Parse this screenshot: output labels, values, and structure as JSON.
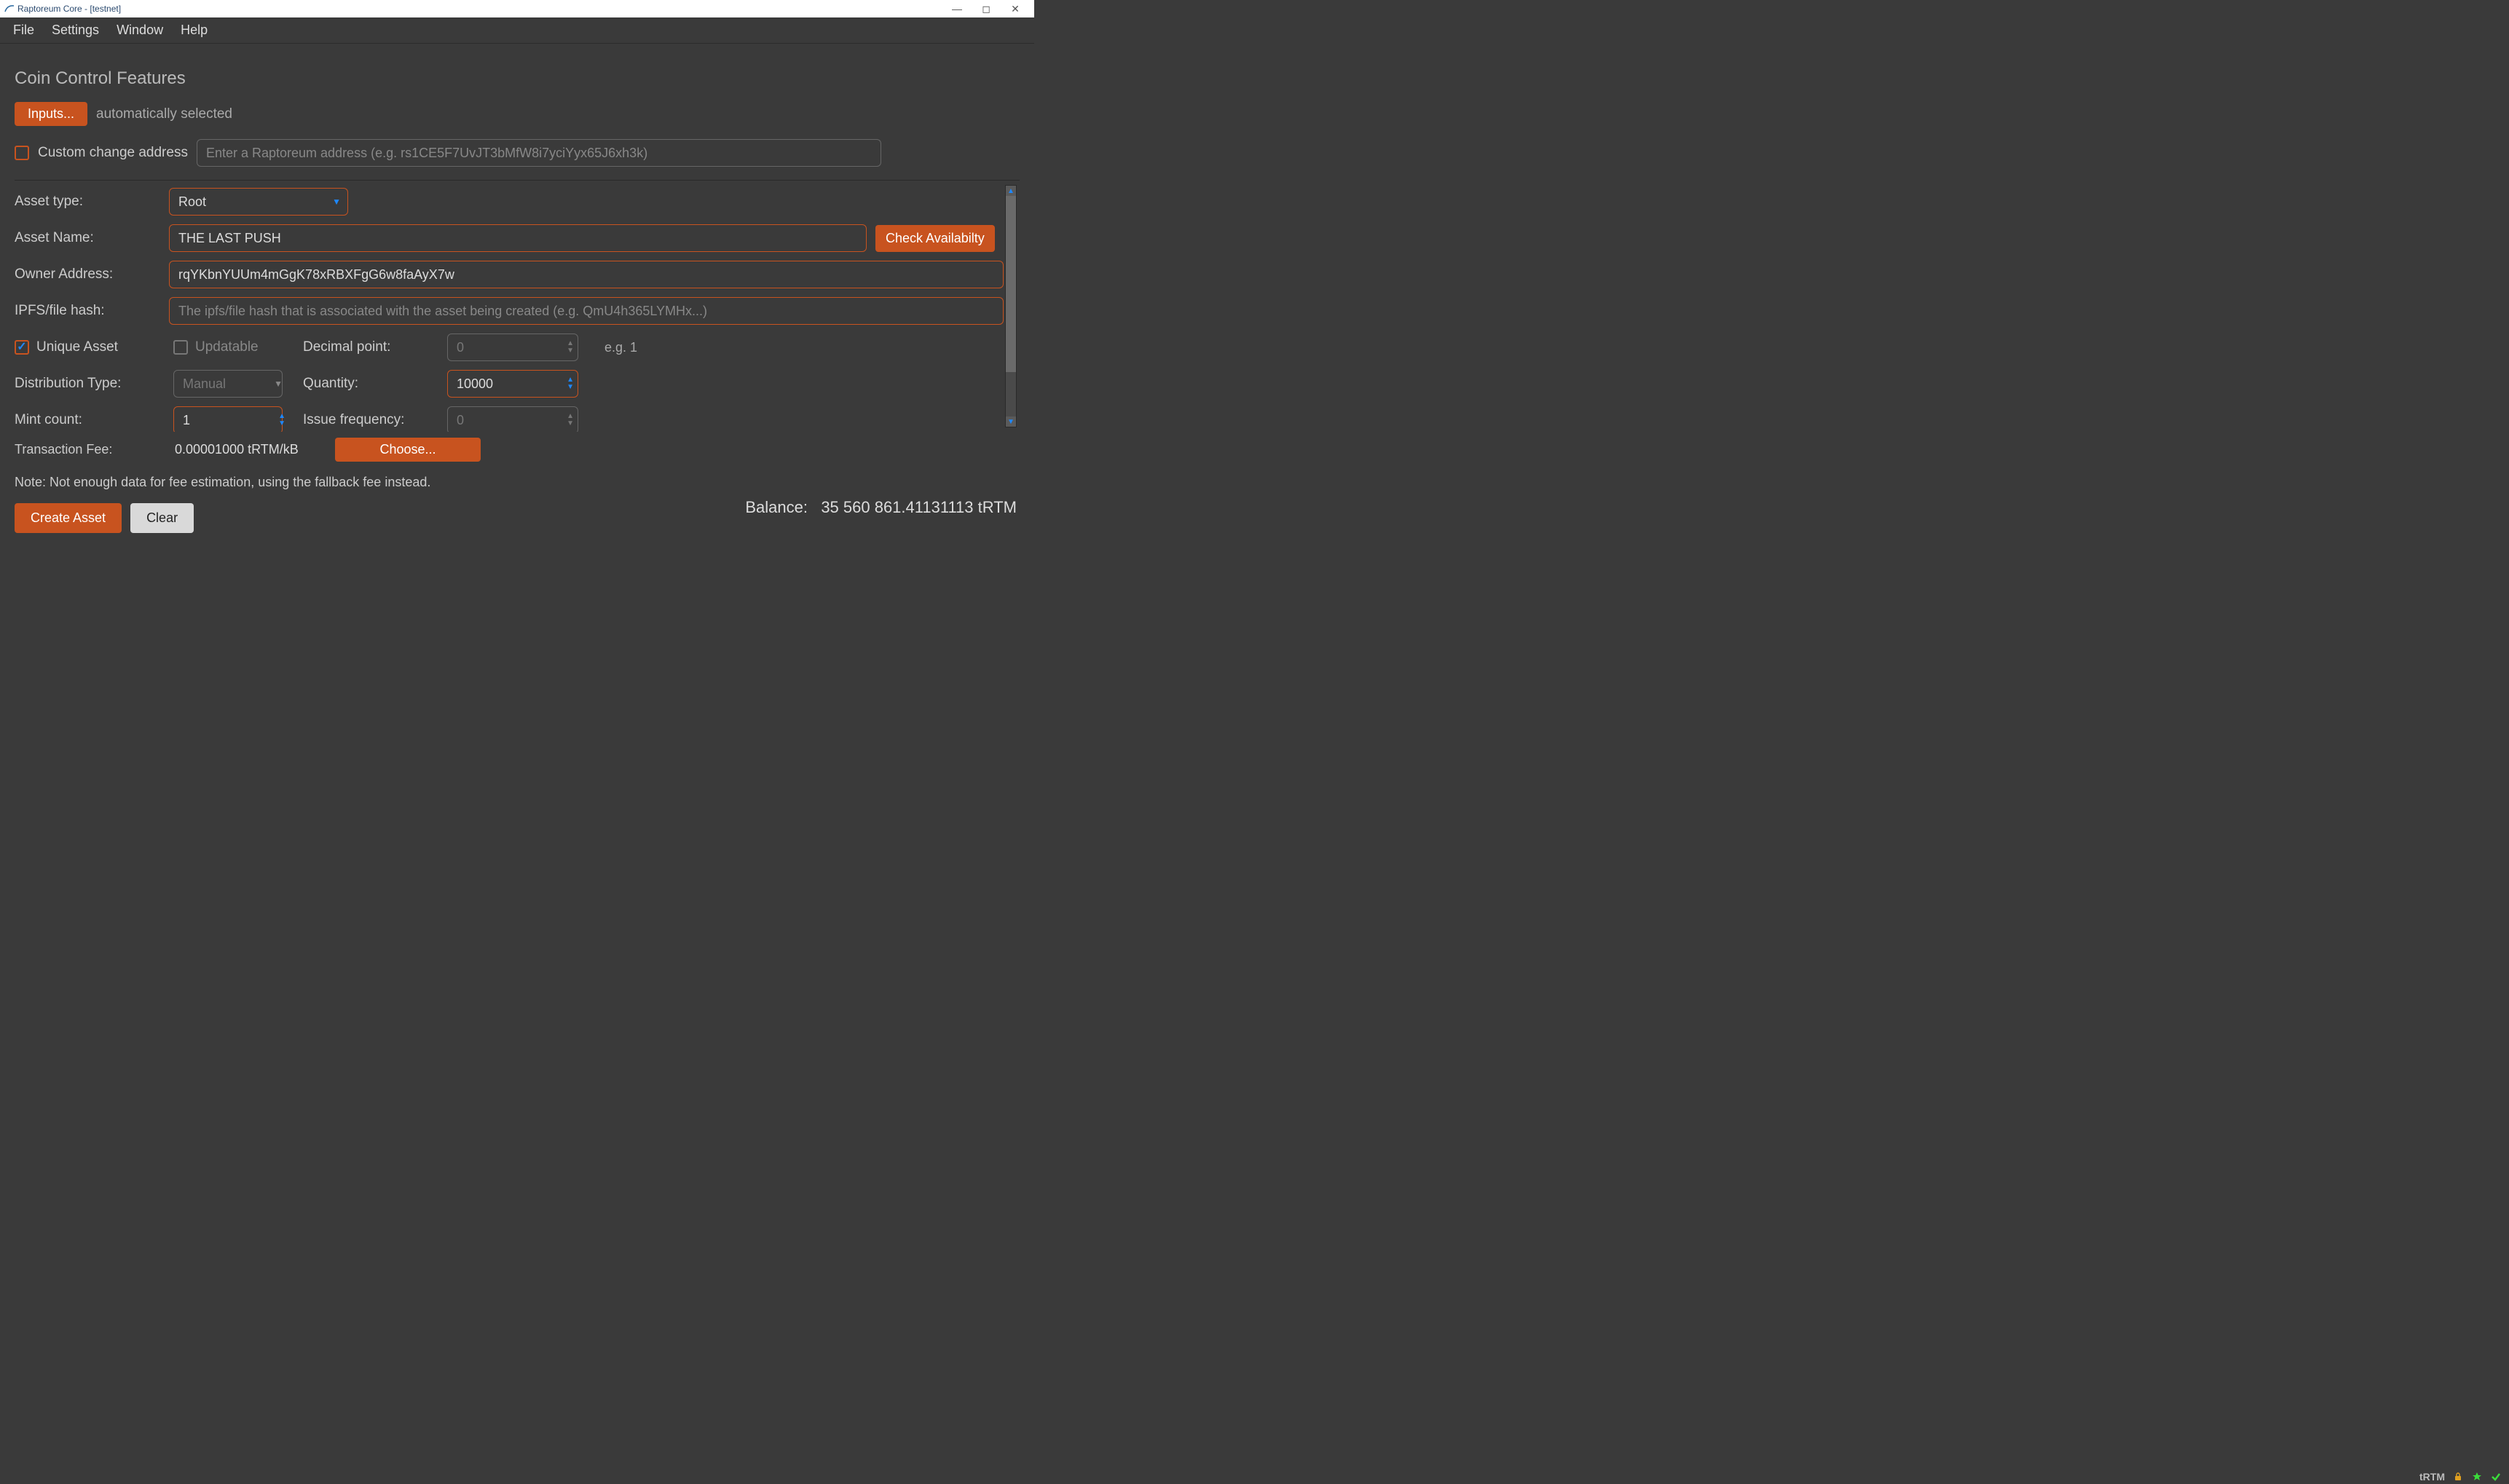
{
  "window": {
    "title": "Raptoreum Core - [testnet]"
  },
  "menu": {
    "file": "File",
    "settings": "Settings",
    "window": "Window",
    "help": "Help"
  },
  "section": {
    "title": "Coin Control Features",
    "inputs_btn": "Inputs...",
    "auto_selected": "automatically selected",
    "custom_change_label": "Custom change address",
    "custom_change_placeholder": "Enter a Raptoreum address (e.g. rs1CE5F7UvJT3bMfW8i7yciYyx65J6xh3k)"
  },
  "form": {
    "asset_type_label": "Asset type:",
    "asset_type_value": "Root",
    "asset_name_label": "Asset Name:",
    "asset_name_value": "THE LAST PUSH",
    "check_avail_btn": "Check Availabilty",
    "owner_addr_label": "Owner Address:",
    "owner_addr_value": "rqYKbnYUUm4mGgK78xRBXFgG6w8faAyX7w",
    "ipfs_label": "IPFS/file hash:",
    "ipfs_placeholder": "The ipfs/file hash that is associated with the asset being created (e.g. QmU4h365LYMHx...)",
    "unique_asset_label": "Unique Asset",
    "updatable_label": "Updatable",
    "decimal_label": "Decimal point:",
    "decimal_value": "0",
    "decimal_hint": "e.g. 1",
    "dist_type_label": "Distribution Type:",
    "dist_type_value": "Manual",
    "quantity_label": "Quantity:",
    "quantity_value": "10000",
    "mint_count_label": "Mint count:",
    "mint_count_value": "1",
    "issue_freq_label": "Issue frequency:",
    "issue_freq_value": "0"
  },
  "fee": {
    "label": "Transaction Fee:",
    "value": "0.00001000 tRTM/kB",
    "choose_btn": "Choose...",
    "note": "Note: Not enough data for fee estimation, using the fallback fee instead."
  },
  "actions": {
    "create": "Create Asset",
    "clear": "Clear"
  },
  "balance": {
    "label": "Balance:",
    "value": "35 560 861.41131113 tRTM"
  },
  "statusbar": {
    "unit": "tRTM"
  }
}
